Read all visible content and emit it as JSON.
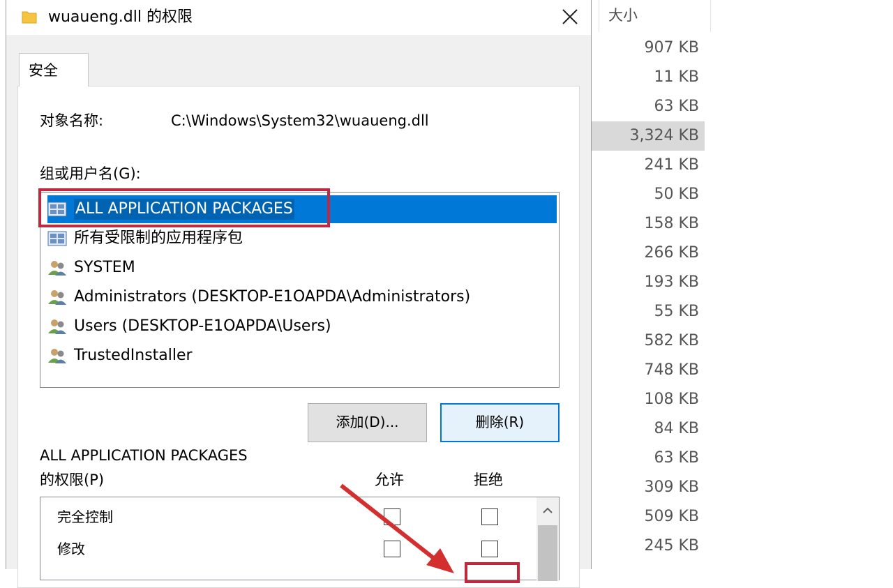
{
  "window": {
    "title": "wuaueng.dll 的权限"
  },
  "tab": {
    "label": "安全"
  },
  "object": {
    "label": "对象名称:",
    "value": "C:\\Windows\\System32\\wuaueng.dll"
  },
  "groups": {
    "label": "组或用户名(G):",
    "items": [
      {
        "name": "ALL APPLICATION PACKAGES",
        "icon": "app-package-icon",
        "selected": true
      },
      {
        "name": "所有受限制的应用程序包",
        "icon": "app-package-icon",
        "selected": false
      },
      {
        "name": "SYSTEM",
        "icon": "users-icon",
        "selected": false
      },
      {
        "name": "Administrators (DESKTOP-E1OAPDA\\Administrators)",
        "icon": "users-icon",
        "selected": false
      },
      {
        "name": "Users (DESKTOP-E1OAPDA\\Users)",
        "icon": "users-icon",
        "selected": false
      },
      {
        "name": "TrustedInstaller",
        "icon": "users-icon",
        "selected": false
      }
    ]
  },
  "buttons": {
    "add": "添加(D)...",
    "remove": "删除(R)"
  },
  "permissions": {
    "title_line1": "ALL APPLICATION PACKAGES",
    "title_line2": "的权限(P)",
    "allow_label": "允许",
    "deny_label": "拒绝",
    "rows": [
      {
        "name": "完全控制",
        "allow": false,
        "deny": false
      },
      {
        "name": "修改",
        "allow": false,
        "deny": false
      }
    ]
  },
  "file_list": {
    "size_header": "大小",
    "sizes": [
      "907 KB",
      "11 KB",
      "63 KB",
      "3,324 KB",
      "241 KB",
      "50 KB",
      "158 KB",
      "266 KB",
      "193 KB",
      "55 KB",
      "582 KB",
      "748 KB",
      "108 KB",
      "84 KB",
      "63 KB",
      "309 KB",
      "509 KB",
      "245 KB"
    ],
    "highlighted_index": 3
  },
  "colors": {
    "selection": "#0078d7",
    "annotation_red": "#c0283d"
  }
}
